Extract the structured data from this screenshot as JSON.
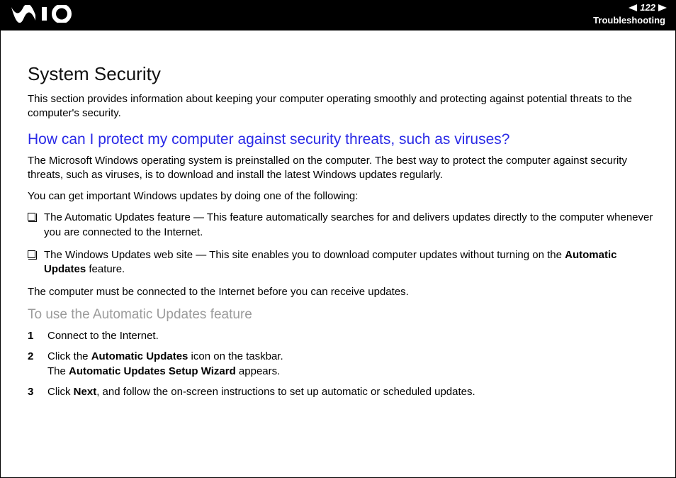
{
  "header": {
    "page_number": "122",
    "section": "Troubleshooting",
    "brand": "VAIO"
  },
  "body": {
    "h1": "System Security",
    "intro": "This section provides information about keeping your computer operating smoothly and protecting against potential threats to the computer's security.",
    "h2": "How can I protect my computer against security threats, such as viruses?",
    "p1": "The Microsoft Windows operating system is preinstalled on the computer. The best way to protect the computer against security threats, such as viruses, is to download and install the latest Windows updates regularly.",
    "p2": "You can get important Windows updates by doing one of the following:",
    "bullets": [
      {
        "text": "The Automatic Updates feature — This feature automatically searches for and delivers updates directly to the computer whenever you are connected to the Internet."
      },
      {
        "pre": "The Windows Updates web site — This site enables you to download computer updates without turning on the ",
        "bold": "Automatic Updates",
        "post": " feature."
      }
    ],
    "p3": "The computer must be connected to the Internet before you can receive updates.",
    "h3": "To use the Automatic Updates feature",
    "steps": [
      {
        "n": "1",
        "text": "Connect to the Internet."
      },
      {
        "n": "2",
        "pre1": "Click the ",
        "b1": "Automatic Updates",
        "mid1": " icon on the taskbar.",
        "br": true,
        "pre2": "The ",
        "b2": "Automatic Updates Setup Wizard",
        "post2": " appears."
      },
      {
        "n": "3",
        "pre1": "Click ",
        "b1": "Next",
        "mid1": ", and follow the on-screen instructions to set up automatic or scheduled updates."
      }
    ]
  }
}
